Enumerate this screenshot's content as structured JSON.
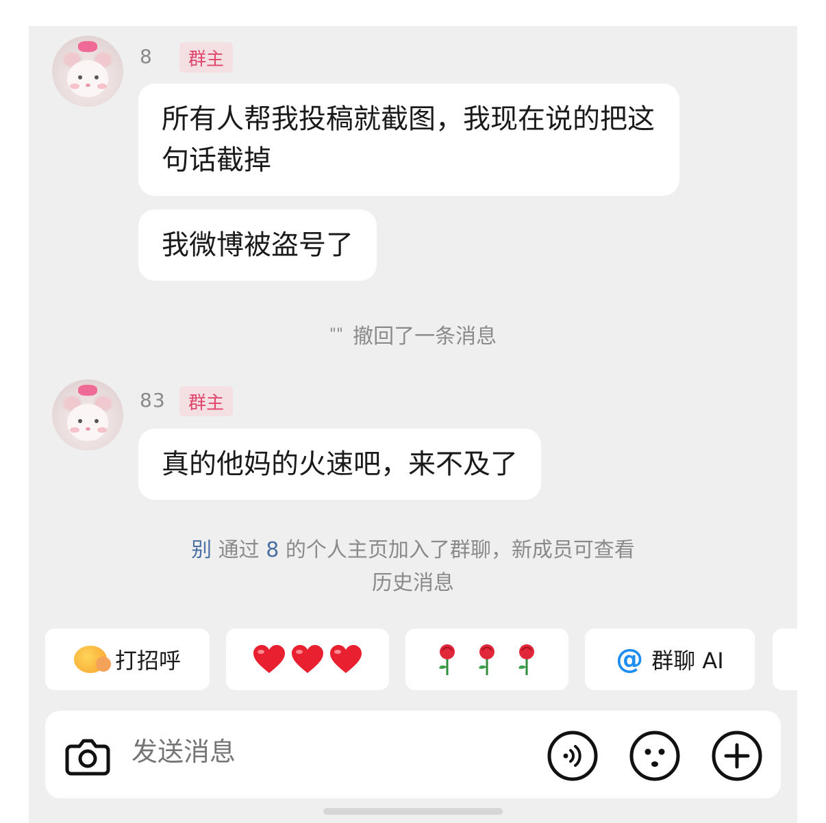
{
  "messages": [
    {
      "sender": "8",
      "role": "群主",
      "bubbles": [
        "所有人帮我投稿就截图，我现在说的把这句话截掉",
        "我微博被盗号了"
      ]
    },
    {
      "sender": "83",
      "role": "群主",
      "bubbles": [
        "真的他妈的火速吧，来不及了"
      ]
    }
  ],
  "recall_note": {
    "quote": "\"\"",
    "text": "撤回了一条消息"
  },
  "join_note": {
    "user": "别",
    "text_before_owner": "通过",
    "owner": "8",
    "text_after_owner": "的个人主页加入了群聊，新成员可查看",
    "line2": "历史消息"
  },
  "quick_replies": [
    {
      "label": "打招呼",
      "icon": "waving-smile-emoji"
    },
    {
      "label": "",
      "icon": "three-hearts-emoji"
    },
    {
      "label": "",
      "icon": "three-roses-emoji"
    },
    {
      "label": "群聊 AI",
      "icon": "at-icon",
      "icon_text": "@"
    }
  ],
  "input": {
    "placeholder": "发送消息"
  },
  "colors": {
    "background": "#efefef",
    "bubble": "#ffffff",
    "badge_bg": "#f4dfe3",
    "badge_text": "#e0466b",
    "link": "#4a6fa3",
    "at_blue": "#1e8df0"
  }
}
